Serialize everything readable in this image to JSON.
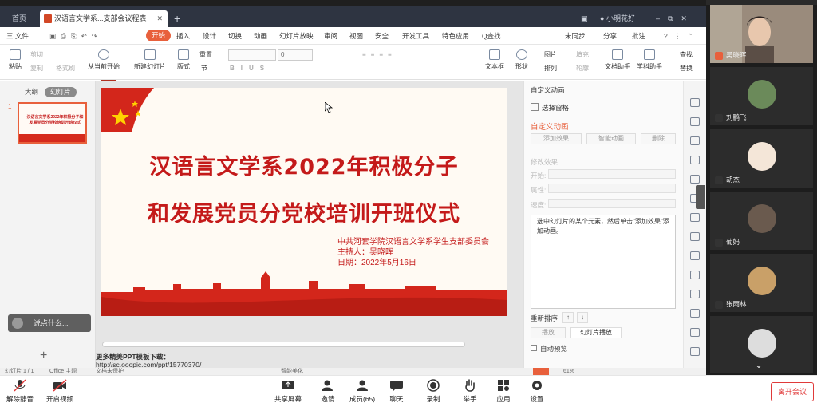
{
  "titlebar": {
    "home_tab": "首页",
    "doc_tab": "汉语言文学系...支部会议程表",
    "user_name": "小明花好"
  },
  "menu": {
    "file": "三 文件",
    "items": [
      "开始",
      "插入",
      "设计",
      "切换",
      "动画",
      "幻灯片放映",
      "审阅",
      "视图",
      "安全",
      "开发工具",
      "特色应用",
      "Q查找"
    ],
    "right_items": [
      "未同步",
      "分享",
      "批注"
    ]
  },
  "toolbar": {
    "paste": "粘贴",
    "cut": "剪切",
    "copy": "复制",
    "format_painter": "格式刷",
    "play_from_current": "从当前开始",
    "new_slide": "新建幻灯片",
    "layout": "版式",
    "section": "节",
    "reset": "重置",
    "font_size": "0",
    "textbox": "文本框",
    "shape": "形状",
    "picture": "图片",
    "arrange": "排列",
    "fill": "填充",
    "outline": "轮廓",
    "doc_assistant": "文档助手",
    "learn_assistant": "学科助手",
    "find": "查找",
    "replace": "替换"
  },
  "left_panel": {
    "tab_outline": "大纲",
    "tab_slides": "幻灯片",
    "slide_number": "1",
    "thumb_text": "汉语言文学系2022年积极分子和发展党员分党校培训开班仪式",
    "comment_placeholder": "说点什么...",
    "add_icon": "+"
  },
  "slide": {
    "title_line1": "汉语言文学系2022年积极分子",
    "title_line2": "和发展党员分党校培训开班仪式",
    "org": "中共河套学院汉语言文学系学生支部委员会",
    "host": "主持人：吴晓晖",
    "date": "日期：2022年5月16日"
  },
  "notes": {
    "line1": "更多精美PPT模板下载：",
    "line2": "http://sc.ooopic.com/ppt/15770370/"
  },
  "animation_panel": {
    "header": "自定义动画",
    "select_pane": "选择窗格",
    "section_title": "自定义动画",
    "add_effect": "添加效果",
    "smart_anim": "智能动画",
    "delete": "删除",
    "modify_effect": "修改效果",
    "start_label": "开始:",
    "property_label": "属性:",
    "speed_label": "速度:",
    "hint": "选中幻灯片的某个元素，然后单击\"添加效果\"添加动画。",
    "reorder": "重新排序",
    "play": "播放",
    "slideshow": "幻灯片播放",
    "autopreview": "自动预览"
  },
  "statusbar": {
    "slide_info": "幻灯片 1 / 1",
    "theme": "Office 主题",
    "doc_status": "文档未保护",
    "beautify": "智能美化",
    "zoom": "61%"
  },
  "participants": [
    {
      "name": "吴晓晖"
    },
    {
      "name": "刘鹏飞"
    },
    {
      "name": "胡杰"
    },
    {
      "name": "葡妈"
    },
    {
      "name": "张雨林"
    },
    {
      "name": ""
    }
  ],
  "meeting_bar": {
    "mute": "解除静音",
    "video": "开启视频",
    "share": "共享屏幕",
    "invite": "邀请",
    "members": "成员(65)",
    "chat": "聊天",
    "record": "录制",
    "raise_hand": "举手",
    "apps": "应用",
    "settings": "设置",
    "leave": "离开会议"
  },
  "colors": {
    "accent": "#e8603c",
    "slide_red": "#c41a1a",
    "leave_red": "#e03a3a"
  }
}
